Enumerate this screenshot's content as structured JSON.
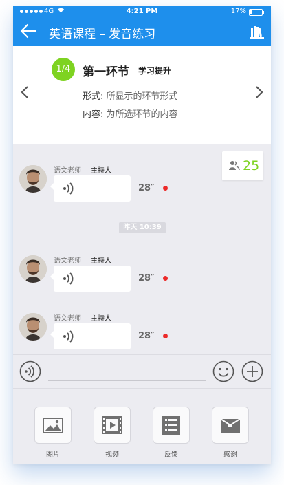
{
  "status_bar": {
    "carrier": "4G",
    "time": "4:21 PM",
    "battery": "17%"
  },
  "nav": {
    "title": "英语课程 – 发音练习",
    "back_icon": "back-arrow-icon",
    "right_icon": "books-icon"
  },
  "stage": {
    "progress": "1/4",
    "title": "第一环节",
    "subtitle": "学习提升",
    "form_label": "形式:",
    "form_value": "所显示的环节形式",
    "content_label": "内容:",
    "content_value": "为所选环节的内容",
    "prev_icon": "chevron-left-icon",
    "next_icon": "chevron-right-icon"
  },
  "participants": {
    "count": "25",
    "icon": "users-icon"
  },
  "messages": [
    {
      "sender": "语文老师",
      "role": "主持人",
      "duration": "28″",
      "unread": true
    },
    {
      "sender": "语文老师",
      "role": "主持人",
      "duration": "28″",
      "unread": true
    },
    {
      "sender": "语文老师",
      "role": "主持人",
      "duration": "28″",
      "unread": true
    }
  ],
  "timestamp": "昨天 10:39",
  "input_bar": {
    "voice_icon": "voice-icon",
    "emoji_icon": "emoji-icon",
    "plus_icon": "plus-icon"
  },
  "tools": [
    {
      "label": "图片",
      "icon": "image-icon"
    },
    {
      "label": "视频",
      "icon": "video-icon"
    },
    {
      "label": "反馈",
      "icon": "feedback-icon"
    },
    {
      "label": "感谢",
      "icon": "gift-icon"
    }
  ],
  "colors": {
    "primary": "#1e8fec",
    "accent_green": "#7ed321",
    "unread_dot": "#ec2a2a",
    "background": "#ececf1"
  }
}
